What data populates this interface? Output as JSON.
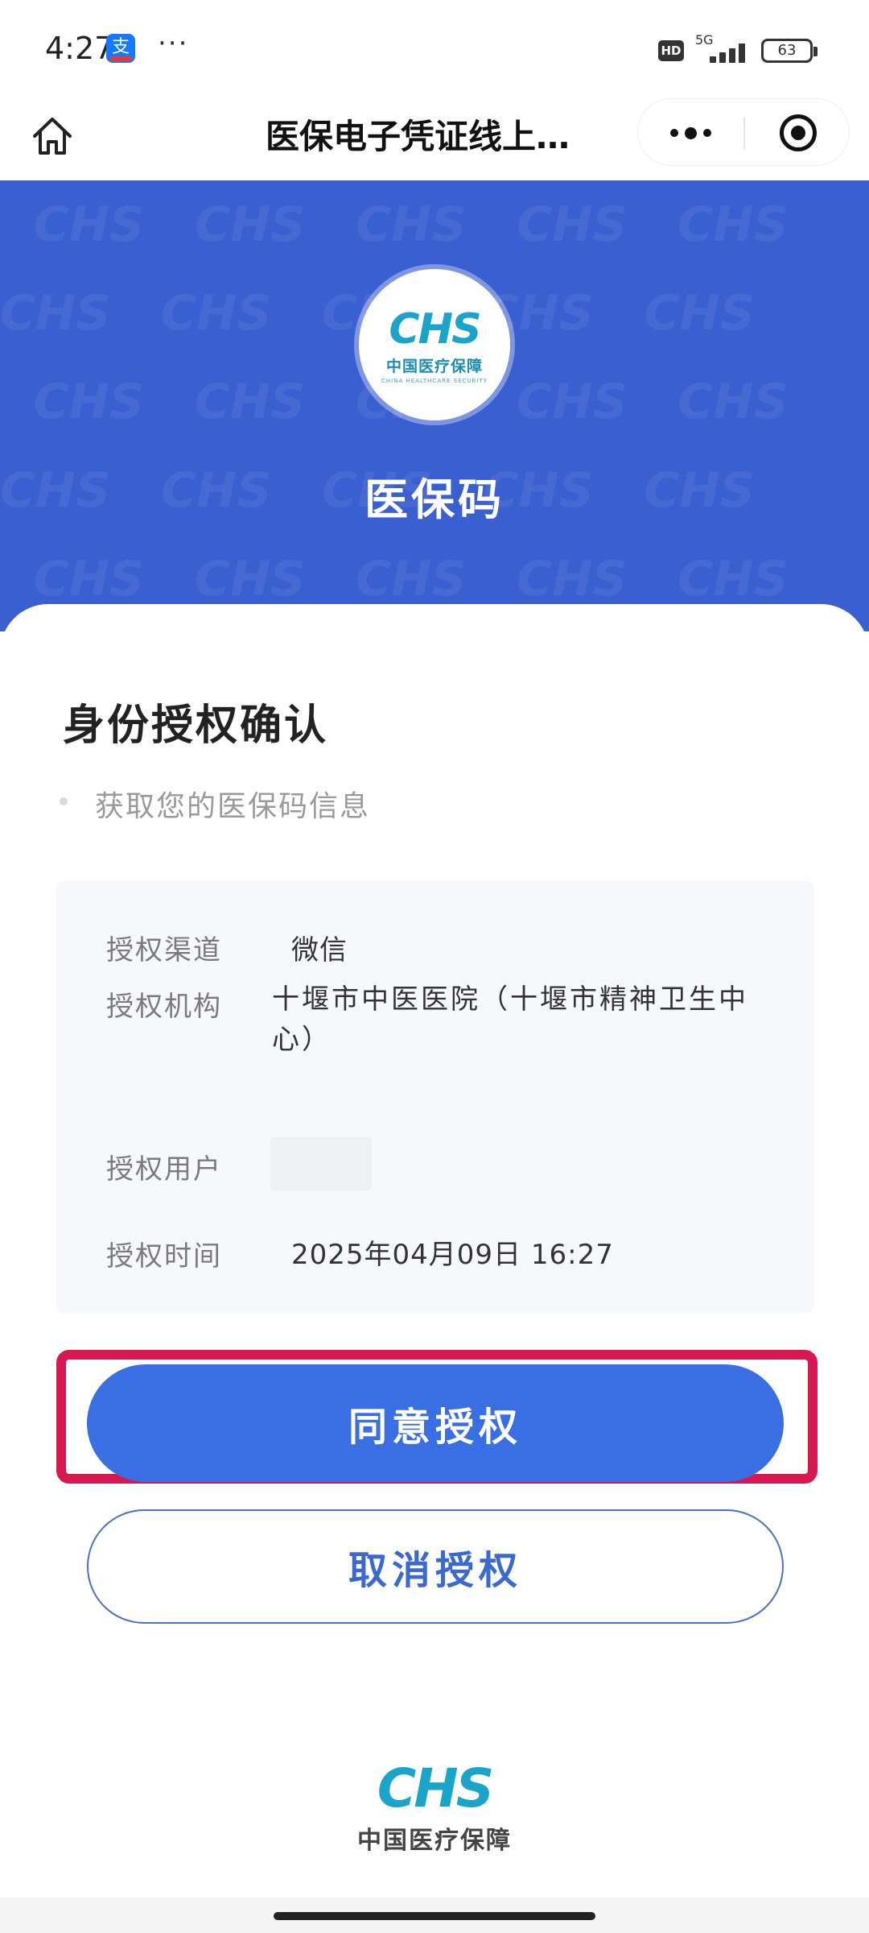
{
  "status_bar": {
    "time": "4:27",
    "app_badge": "支",
    "more": "···",
    "hd": "HD",
    "network": "5G",
    "battery": "63"
  },
  "nav": {
    "title": "医保电子凭证线上…"
  },
  "banner": {
    "logo_mark": "CHS",
    "logo_cn": "中国医疗保障",
    "logo_en": "CHINA HEALTHCARE SECURITY",
    "title": "医保码"
  },
  "auth": {
    "title": "身份授权确认",
    "scope": "获取您的医保码信息",
    "rows": [
      {
        "label": "授权渠道",
        "value": "微信"
      },
      {
        "label": "授权机构",
        "value": "十堰市中医医院（十堰市精神卫生中心）"
      },
      {
        "label": "授权用户",
        "value": ""
      },
      {
        "label": "授权时间",
        "value": "2025年04月09日  16:27"
      }
    ]
  },
  "buttons": {
    "agree": "同意授权",
    "cancel": "取消授权"
  },
  "footer": {
    "logo_mark": "CHS",
    "logo_cn": "中国医疗保障"
  },
  "colors": {
    "banner": "#3a5fd1",
    "primary": "#3a6fe4",
    "highlight": "#d8164f",
    "logo": "#1aa4c9"
  }
}
